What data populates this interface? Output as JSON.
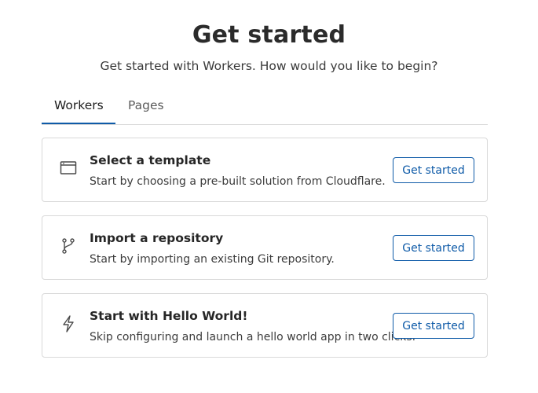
{
  "header": {
    "title": "Get started",
    "subtitle": "Get started with Workers. How would you like to begin?"
  },
  "tabs": [
    {
      "label": "Workers",
      "active": true
    },
    {
      "label": "Pages",
      "active": false
    }
  ],
  "options": [
    {
      "icon": "browser-window-icon",
      "title": "Select a template",
      "description": "Start by choosing a pre-built solution from Cloudflare.",
      "button": "Get started"
    },
    {
      "icon": "git-branch-icon",
      "title": "Import a repository",
      "description": "Start by importing an existing Git repository.",
      "button": "Get started"
    },
    {
      "icon": "lightning-bolt-icon",
      "title": "Start with Hello World!",
      "description": "Skip configuring and launch a hello world app in two clicks.",
      "button": "Get started"
    }
  ],
  "colors": {
    "accent": "#0f5ba8",
    "border": "#d9d9d9"
  }
}
